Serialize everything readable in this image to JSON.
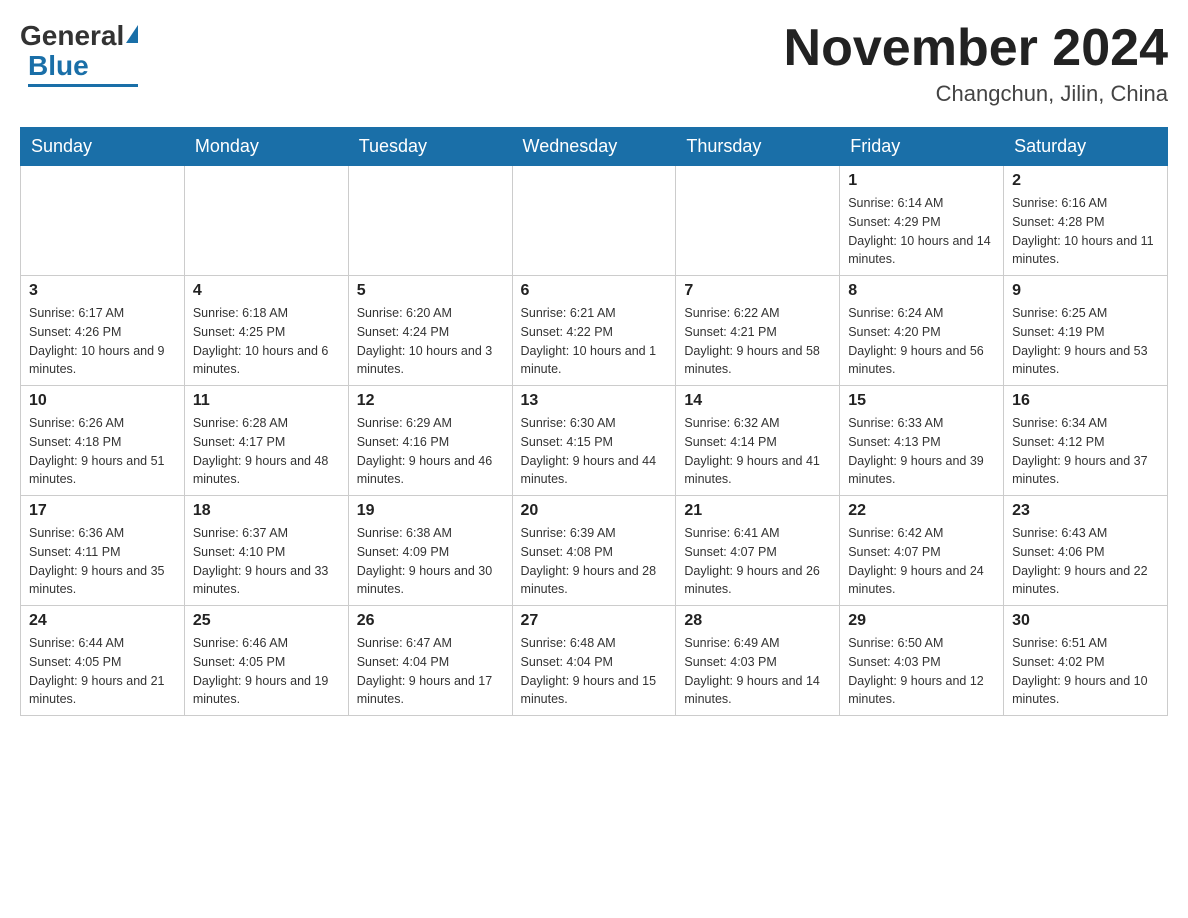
{
  "header": {
    "logo": {
      "general": "General",
      "blue": "Blue"
    },
    "title": "November 2024",
    "location": "Changchun, Jilin, China"
  },
  "weekdays": [
    "Sunday",
    "Monday",
    "Tuesday",
    "Wednesday",
    "Thursday",
    "Friday",
    "Saturday"
  ],
  "weeks": [
    [
      {
        "day": "",
        "info": ""
      },
      {
        "day": "",
        "info": ""
      },
      {
        "day": "",
        "info": ""
      },
      {
        "day": "",
        "info": ""
      },
      {
        "day": "",
        "info": ""
      },
      {
        "day": "1",
        "info": "Sunrise: 6:14 AM\nSunset: 4:29 PM\nDaylight: 10 hours and 14 minutes."
      },
      {
        "day": "2",
        "info": "Sunrise: 6:16 AM\nSunset: 4:28 PM\nDaylight: 10 hours and 11 minutes."
      }
    ],
    [
      {
        "day": "3",
        "info": "Sunrise: 6:17 AM\nSunset: 4:26 PM\nDaylight: 10 hours and 9 minutes."
      },
      {
        "day": "4",
        "info": "Sunrise: 6:18 AM\nSunset: 4:25 PM\nDaylight: 10 hours and 6 minutes."
      },
      {
        "day": "5",
        "info": "Sunrise: 6:20 AM\nSunset: 4:24 PM\nDaylight: 10 hours and 3 minutes."
      },
      {
        "day": "6",
        "info": "Sunrise: 6:21 AM\nSunset: 4:22 PM\nDaylight: 10 hours and 1 minute."
      },
      {
        "day": "7",
        "info": "Sunrise: 6:22 AM\nSunset: 4:21 PM\nDaylight: 9 hours and 58 minutes."
      },
      {
        "day": "8",
        "info": "Sunrise: 6:24 AM\nSunset: 4:20 PM\nDaylight: 9 hours and 56 minutes."
      },
      {
        "day": "9",
        "info": "Sunrise: 6:25 AM\nSunset: 4:19 PM\nDaylight: 9 hours and 53 minutes."
      }
    ],
    [
      {
        "day": "10",
        "info": "Sunrise: 6:26 AM\nSunset: 4:18 PM\nDaylight: 9 hours and 51 minutes."
      },
      {
        "day": "11",
        "info": "Sunrise: 6:28 AM\nSunset: 4:17 PM\nDaylight: 9 hours and 48 minutes."
      },
      {
        "day": "12",
        "info": "Sunrise: 6:29 AM\nSunset: 4:16 PM\nDaylight: 9 hours and 46 minutes."
      },
      {
        "day": "13",
        "info": "Sunrise: 6:30 AM\nSunset: 4:15 PM\nDaylight: 9 hours and 44 minutes."
      },
      {
        "day": "14",
        "info": "Sunrise: 6:32 AM\nSunset: 4:14 PM\nDaylight: 9 hours and 41 minutes."
      },
      {
        "day": "15",
        "info": "Sunrise: 6:33 AM\nSunset: 4:13 PM\nDaylight: 9 hours and 39 minutes."
      },
      {
        "day": "16",
        "info": "Sunrise: 6:34 AM\nSunset: 4:12 PM\nDaylight: 9 hours and 37 minutes."
      }
    ],
    [
      {
        "day": "17",
        "info": "Sunrise: 6:36 AM\nSunset: 4:11 PM\nDaylight: 9 hours and 35 minutes."
      },
      {
        "day": "18",
        "info": "Sunrise: 6:37 AM\nSunset: 4:10 PM\nDaylight: 9 hours and 33 minutes."
      },
      {
        "day": "19",
        "info": "Sunrise: 6:38 AM\nSunset: 4:09 PM\nDaylight: 9 hours and 30 minutes."
      },
      {
        "day": "20",
        "info": "Sunrise: 6:39 AM\nSunset: 4:08 PM\nDaylight: 9 hours and 28 minutes."
      },
      {
        "day": "21",
        "info": "Sunrise: 6:41 AM\nSunset: 4:07 PM\nDaylight: 9 hours and 26 minutes."
      },
      {
        "day": "22",
        "info": "Sunrise: 6:42 AM\nSunset: 4:07 PM\nDaylight: 9 hours and 24 minutes."
      },
      {
        "day": "23",
        "info": "Sunrise: 6:43 AM\nSunset: 4:06 PM\nDaylight: 9 hours and 22 minutes."
      }
    ],
    [
      {
        "day": "24",
        "info": "Sunrise: 6:44 AM\nSunset: 4:05 PM\nDaylight: 9 hours and 21 minutes."
      },
      {
        "day": "25",
        "info": "Sunrise: 6:46 AM\nSunset: 4:05 PM\nDaylight: 9 hours and 19 minutes."
      },
      {
        "day": "26",
        "info": "Sunrise: 6:47 AM\nSunset: 4:04 PM\nDaylight: 9 hours and 17 minutes."
      },
      {
        "day": "27",
        "info": "Sunrise: 6:48 AM\nSunset: 4:04 PM\nDaylight: 9 hours and 15 minutes."
      },
      {
        "day": "28",
        "info": "Sunrise: 6:49 AM\nSunset: 4:03 PM\nDaylight: 9 hours and 14 minutes."
      },
      {
        "day": "29",
        "info": "Sunrise: 6:50 AM\nSunset: 4:03 PM\nDaylight: 9 hours and 12 minutes."
      },
      {
        "day": "30",
        "info": "Sunrise: 6:51 AM\nSunset: 4:02 PM\nDaylight: 9 hours and 10 minutes."
      }
    ]
  ]
}
